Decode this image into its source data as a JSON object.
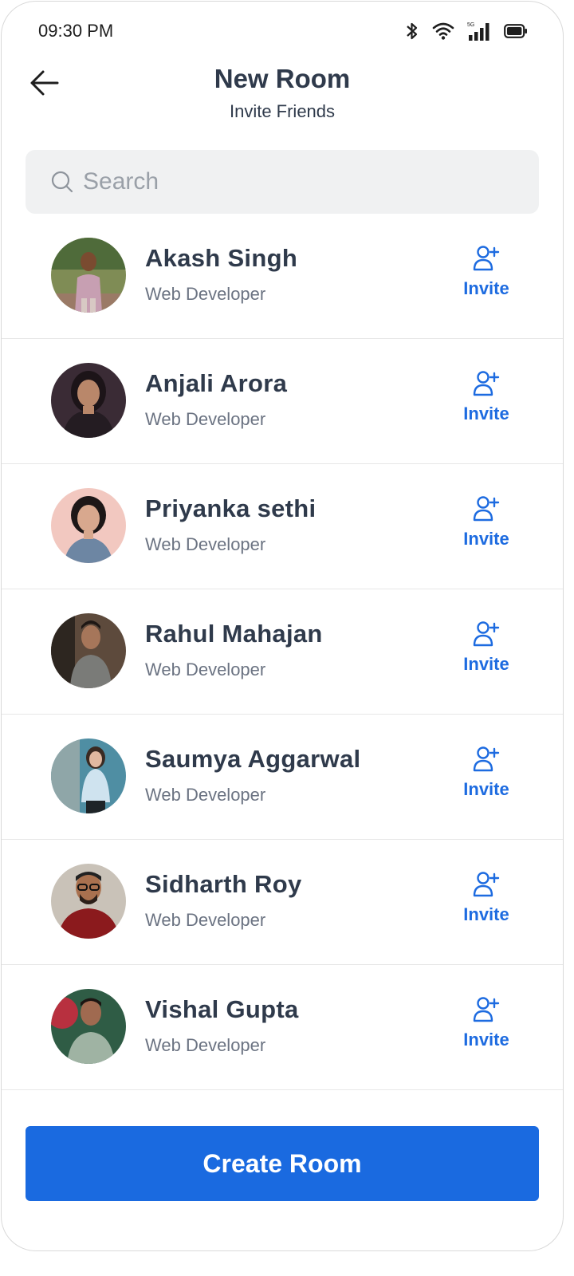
{
  "status_bar": {
    "time": "09:30 PM",
    "network_label": "5G",
    "icons": [
      "bluetooth-icon",
      "wifi-icon",
      "signal-icon",
      "battery-icon"
    ]
  },
  "header": {
    "title": "New Room",
    "subtitle": "Invite Friends",
    "back_icon": "arrow-left-icon"
  },
  "search": {
    "placeholder": "Search",
    "value": ""
  },
  "contacts": [
    {
      "name": "Akash Singh",
      "role": "Web Developer",
      "invite_label": "Invite"
    },
    {
      "name": "Anjali Arora",
      "role": "Web Developer",
      "invite_label": "Invite"
    },
    {
      "name": "Priyanka sethi",
      "role": "Web Developer",
      "invite_label": "Invite"
    },
    {
      "name": "Rahul Mahajan",
      "role": "Web Developer",
      "invite_label": "Invite"
    },
    {
      "name": "Saumya Aggarwal",
      "role": "Web Developer",
      "invite_label": "Invite"
    },
    {
      "name": "Sidharth Roy",
      "role": "Web Developer",
      "invite_label": "Invite"
    },
    {
      "name": "Vishal Gupta",
      "role": "Web Developer",
      "invite_label": "Invite"
    }
  ],
  "footer": {
    "create_button_label": "Create Room"
  },
  "colors": {
    "accent": "#1a6ae0",
    "text_primary": "#2f3a4b",
    "text_secondary": "#6b7382",
    "search_bg": "#f0f1f2"
  }
}
